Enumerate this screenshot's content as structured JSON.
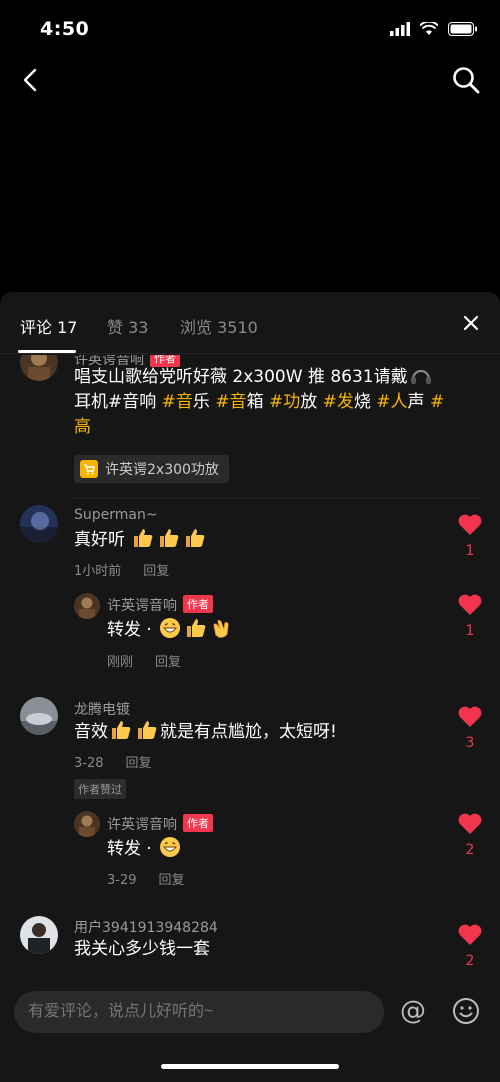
{
  "status_bar": {
    "time": "4:50"
  },
  "tabs": [
    {
      "label": "评论 17",
      "active": true
    },
    {
      "label": "赞 33",
      "active": false
    },
    {
      "label": "浏览 3510",
      "active": false
    }
  ],
  "comments": {
    "top": {
      "name": "许英谔音响",
      "author_tag": "作者",
      "text_line1": "唱支山歌给党听好薇 2x300W 推 8631请戴",
      "text_line2_a": "耳机#音响 ",
      "text_line2_tags": [
        "#音",
        "乐 ",
        "#音",
        "箱 ",
        "#功",
        "放 ",
        "#发",
        "烧 ",
        "#人",
        "声 ",
        "#"
      ],
      "text_line3": "高",
      "product_label": "许英谔2x300功放"
    },
    "c1": {
      "name": "Superman~",
      "text": "真好听",
      "time": "1小时前",
      "reply": "回复",
      "likes": "1"
    },
    "r1": {
      "name": "许英谔音响",
      "author_tag": "作者",
      "text": "转发 ·",
      "time": "刚刚",
      "reply": "回复",
      "likes": "1"
    },
    "c2": {
      "name": "龙腾电镀",
      "text_pre": "音效",
      "text_post": "就是有点尴尬，太短呀!",
      "time": "3-28",
      "reply": "回复",
      "author_liked": "作者赞过",
      "likes": "3"
    },
    "r2": {
      "name": "许英谔音响",
      "author_tag": "作者",
      "text": "转发 ·",
      "time": "3-29",
      "reply": "回复",
      "likes": "2"
    },
    "c3": {
      "name": "用户3941913948284",
      "text": "我关心多少钱一套",
      "likes": "2"
    }
  },
  "input": {
    "placeholder": "有爱评论，说点儿好听的~",
    "at_symbol": "@"
  },
  "colors": {
    "accent": "#f2364d",
    "hashtag": "#f7b500",
    "sheet_bg": "#161616"
  }
}
